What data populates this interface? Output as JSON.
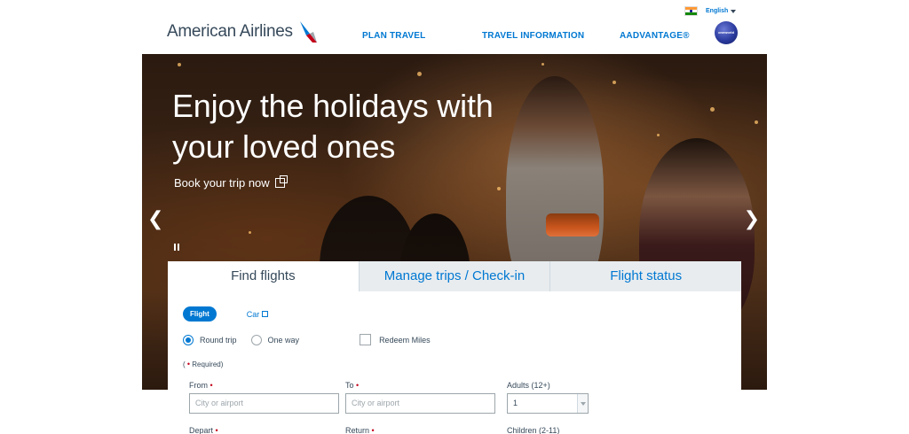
{
  "header": {
    "language": "English",
    "logo_text": "American Airlines",
    "nav": {
      "plan_travel": "PLAN TRAVEL",
      "travel_information": "TRAVEL INFORMATION",
      "aadvantage": "AADVANTAGE®"
    },
    "oneworld_label": "oneworld"
  },
  "hero": {
    "title_line1": "Enjoy the holidays with",
    "title_line2": "your loved ones",
    "cta": "Book your trip now",
    "prev_arrow": "❮",
    "next_arrow": "❯"
  },
  "booking": {
    "tabs": [
      "Find flights",
      "Manage trips / Check-in",
      "Flight status"
    ],
    "modes": {
      "flight": "Flight",
      "car": "Car"
    },
    "trip_types": {
      "round_trip": "Round trip",
      "one_way": "One way",
      "redeem": "Redeem Miles"
    },
    "selected_trip_type": "round_trip",
    "required_note": "Required",
    "from": {
      "label": "From",
      "placeholder": "City or airport"
    },
    "to": {
      "label": "To",
      "placeholder": "City or airport"
    },
    "adults": {
      "label": "Adults (12+)",
      "value": "1"
    },
    "depart": {
      "label": "Depart"
    },
    "return": {
      "label": "Return"
    },
    "children": {
      "label": "Children (2-11)"
    }
  },
  "colors": {
    "brand_blue": "#0078d2",
    "text_dark": "#36495a",
    "required_red": "#c30019"
  }
}
